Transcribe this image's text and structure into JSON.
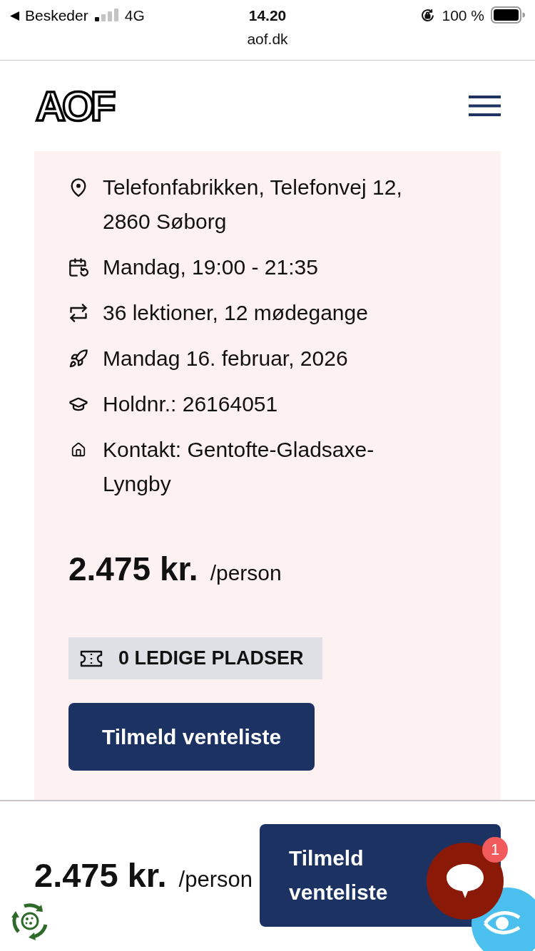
{
  "status_bar": {
    "back_arrow": "◀",
    "back_app": "Beskeder",
    "network": "4G",
    "time": "14.20",
    "battery": "100 %"
  },
  "address_bar": {
    "url": "aof.dk"
  },
  "header": {
    "logo": "AOF"
  },
  "course_details": [
    {
      "kind": "location",
      "text": "Telefonfabrikken, Telefonvej 12, 2860 Søborg"
    },
    {
      "kind": "schedule",
      "text": "Mandag, 19:00 - 21:35"
    },
    {
      "kind": "lessons",
      "text": "36 lektioner, 12 mødegange"
    },
    {
      "kind": "start_date",
      "text": "Mandag 16. februar, 2026"
    },
    {
      "kind": "team_number",
      "text": "Holdnr.: 26164051"
    },
    {
      "kind": "contact",
      "text": "Kontakt: Gentofte-Gladsaxe-Lyngby"
    }
  ],
  "price": {
    "amount": "2.475 kr.",
    "unit": "/person"
  },
  "availability": {
    "text": "0 LEDIGE PLADSER"
  },
  "waitlist_button": {
    "label": "Tilmeld venteliste"
  },
  "sticky_bar": {
    "amount": "2.475 kr.",
    "unit": "/person",
    "button_label": "Tilmeld venteliste"
  },
  "chat": {
    "unread_count": "1"
  }
}
